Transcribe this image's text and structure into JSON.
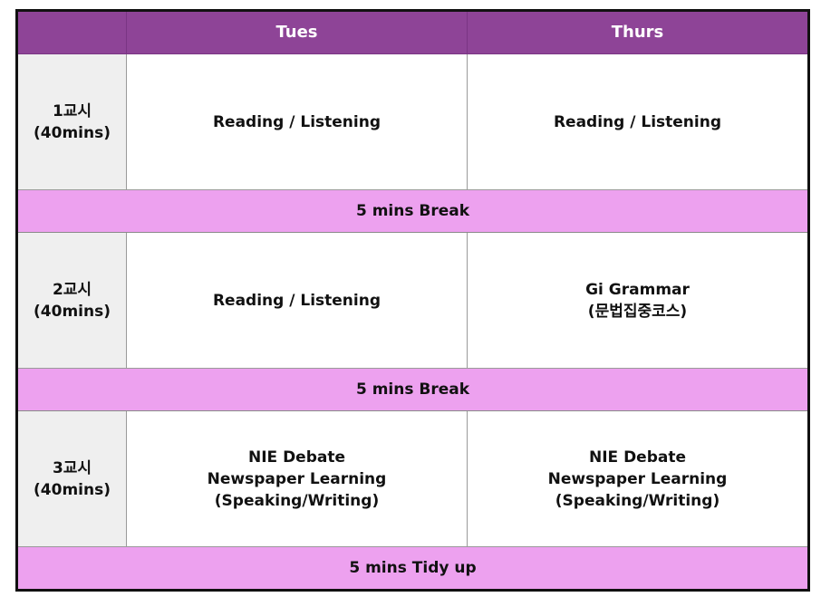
{
  "header": {
    "corner": "",
    "tuesday": "Tues",
    "thursday": "Thurs"
  },
  "rows": [
    {
      "period": "1교시",
      "duration": "(40mins)",
      "tues": [
        "Reading / Listening"
      ],
      "thurs": [
        "Reading / Listening"
      ]
    },
    {
      "period": "2교시",
      "duration": "(40mins)",
      "tues": [
        "Reading / Listening"
      ],
      "thurs": [
        "Gi Grammar",
        "(문법집중코스)"
      ]
    },
    {
      "period": "3교시",
      "duration": "(40mins)",
      "tues": [
        "NIE Debate",
        "Newspaper Learning",
        "(Speaking/Writing)"
      ],
      "thurs": [
        "NIE Debate",
        "Newspaper Learning",
        "(Speaking/Writing)"
      ]
    }
  ],
  "breaks": [
    "5 mins Break",
    "5 mins Break",
    "5 mins Tidy up"
  ],
  "colors": {
    "header": "#8e4497",
    "break": "#eda1ef",
    "period_column": "#efefef"
  }
}
